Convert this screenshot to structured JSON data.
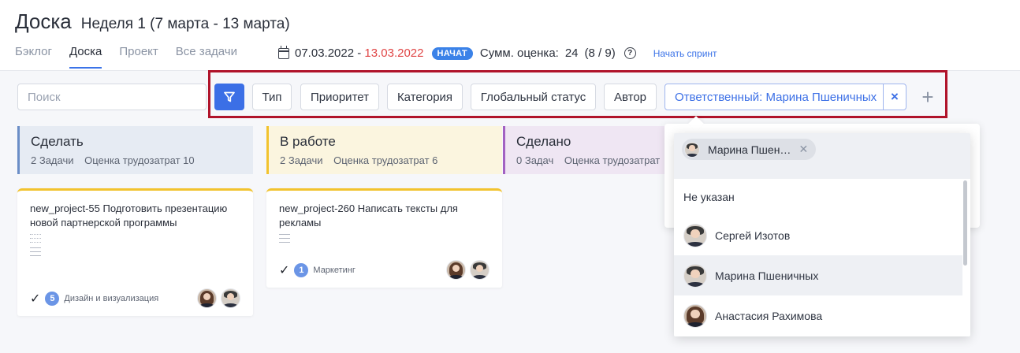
{
  "header": {
    "title": "Доска",
    "sprint_title": "Неделя 1 (7 марта - 13 марта)",
    "tabs": [
      {
        "label": "Бэклог",
        "active": false
      },
      {
        "label": "Доска",
        "active": true
      },
      {
        "label": "Проект",
        "active": false
      },
      {
        "label": "Все задачи",
        "active": false
      }
    ],
    "date_start": "07.03.2022",
    "date_sep": " - ",
    "date_end": "13.03.2022",
    "status_badge": "НАЧАТ",
    "sum_label": "Сумм. оценка:",
    "sum_value": "24",
    "sum_detail": "(8 / 9)",
    "help_glyph": "?",
    "start_sprint_link": "Начать спринт",
    "colors": {
      "accent": "#3b6fe6",
      "date_end": "#e04545",
      "badge": "#3b82e8",
      "highlight_border": "#b0132a"
    }
  },
  "filters": {
    "search_placeholder": "Поиск",
    "chips": [
      "Тип",
      "Приоритет",
      "Категория",
      "Глобальный статус",
      "Автор"
    ],
    "responsible_chip": "Ответственный: Марина Пшеничных",
    "clear_glyph": "×",
    "add_glyph": "+"
  },
  "columns": [
    {
      "name": "Сделать",
      "count": "2 Задачи",
      "estimate": "Оценка трудозатрат 10",
      "color": "#e6ebf3",
      "border": "#6b8ec7"
    },
    {
      "name": "В работе",
      "count": "2 Задачи",
      "estimate": "Оценка трудозатрат 6",
      "color": "#fbf5df",
      "border": "#f2c32e"
    },
    {
      "name": "Сделано",
      "count": "0 Задач",
      "estimate": "Оценка трудозатрат",
      "color": "#efe6f3",
      "border": "#a262c2"
    }
  ],
  "cards": [
    {
      "key": "new_project-55",
      "title_first": "Подготовить",
      "title_rest": "презентацию новой партнерской программы",
      "count": "5",
      "category": "Дизайн и визуализация",
      "check_glyph": "✓"
    },
    {
      "key": "new_project-260",
      "title_first": "Написать тексты для",
      "title_rest": "рекламы",
      "count": "1",
      "category": "Маркетинг",
      "check_glyph": "✓"
    }
  ],
  "dropdown": {
    "selected_chip": "Марина Пшен…",
    "remove_glyph": "✕",
    "items": [
      {
        "label": "Не указан"
      },
      {
        "label": "Сергей Изотов"
      },
      {
        "label": "Марина Пшеничных"
      },
      {
        "label": "Анастасия Рахимова"
      }
    ]
  }
}
